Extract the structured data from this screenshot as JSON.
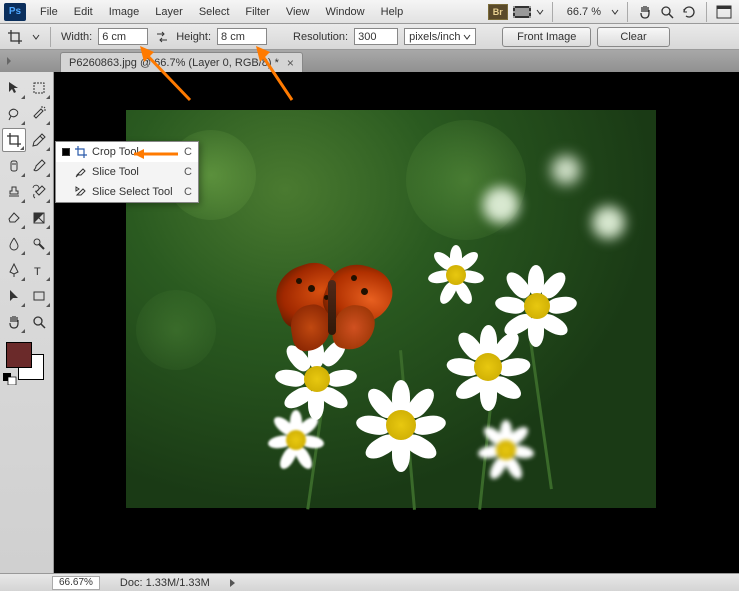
{
  "app": {
    "logo": "Ps"
  },
  "menu": [
    "File",
    "Edit",
    "Image",
    "Layer",
    "Select",
    "Filter",
    "View",
    "Window",
    "Help"
  ],
  "topright": {
    "br": "Br",
    "zoom": "66.7 %"
  },
  "options": {
    "width_label": "Width:",
    "width_value": "6 cm",
    "height_label": "Height:",
    "height_value": "8 cm",
    "res_label": "Resolution:",
    "res_value": "300",
    "unit": "pixels/inch",
    "front_image": "Front Image",
    "clear": "Clear"
  },
  "tab": {
    "title": "P6260863.jpg @ 66.7% (Layer 0, RGB/8) *"
  },
  "flyout": {
    "items": [
      {
        "label": "Crop Tool",
        "key": "C",
        "selected": true,
        "icon": "crop"
      },
      {
        "label": "Slice Tool",
        "key": "C",
        "selected": false,
        "icon": "slice"
      },
      {
        "label": "Slice Select Tool",
        "key": "C",
        "selected": false,
        "icon": "slice-select"
      }
    ]
  },
  "status": {
    "zoom": "66.67%",
    "doc": "Doc: 1.33M/1.33M"
  },
  "swatch": {
    "fg": "#6b2a2a",
    "bg": "#ffffff"
  }
}
